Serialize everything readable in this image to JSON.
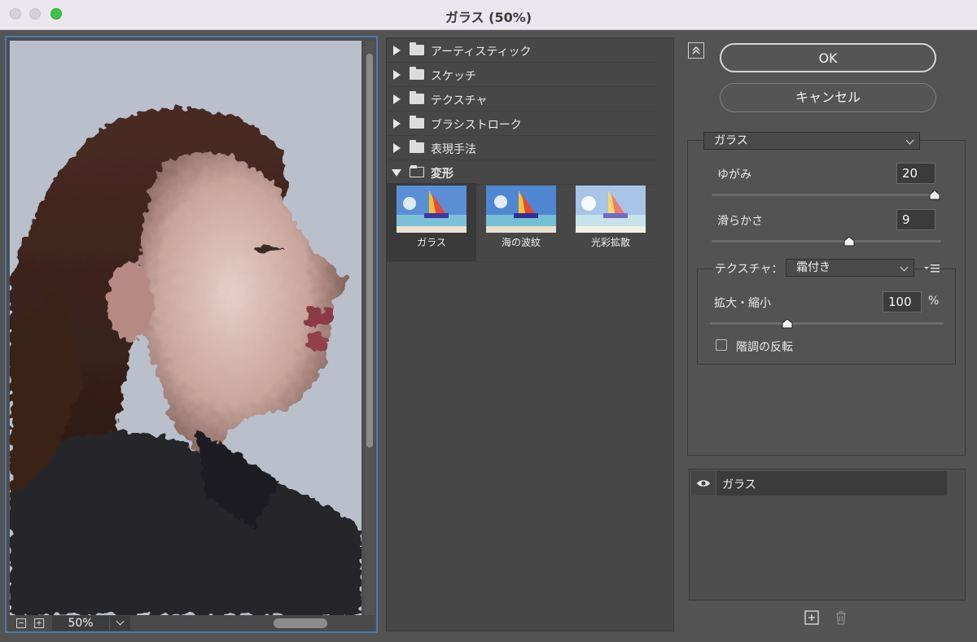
{
  "window": {
    "title": "ガラス (50%)"
  },
  "preview": {
    "zoom": "50%"
  },
  "filter_gallery": {
    "categories": [
      {
        "label": "アーティスティック",
        "expanded": false
      },
      {
        "label": "スケッチ",
        "expanded": false
      },
      {
        "label": "テクスチャ",
        "expanded": false
      },
      {
        "label": "ブラシストローク",
        "expanded": false
      },
      {
        "label": "表現手法",
        "expanded": false
      },
      {
        "label": "変形",
        "expanded": true
      }
    ],
    "thumbnails": [
      {
        "label": "ガラス",
        "selected": true
      },
      {
        "label": "海の波紋",
        "selected": false
      },
      {
        "label": "光彩拡散",
        "selected": false
      }
    ]
  },
  "buttons": {
    "ok": "OK",
    "cancel": "キャンセル"
  },
  "settings": {
    "filter_select": "ガラス",
    "distortion": {
      "label": "ゆがみ",
      "value": "20",
      "fraction": 1.0
    },
    "smoothness": {
      "label": "滑らかさ",
      "value": "9",
      "fraction": 0.6
    },
    "texture": {
      "label": "テクスチャ：",
      "value": "霜付き"
    },
    "scaling": {
      "label": "拡大・縮小",
      "value": "100",
      "unit": "%",
      "fraction": 0.33
    },
    "invert": {
      "label": "階調の反転",
      "checked": false
    }
  },
  "layers": {
    "items": [
      {
        "name": "ガラス",
        "visible": true
      }
    ]
  },
  "colors": {
    "accent_border": "#4a79ab",
    "panel": "#535353",
    "green_button": "#3ec344"
  }
}
